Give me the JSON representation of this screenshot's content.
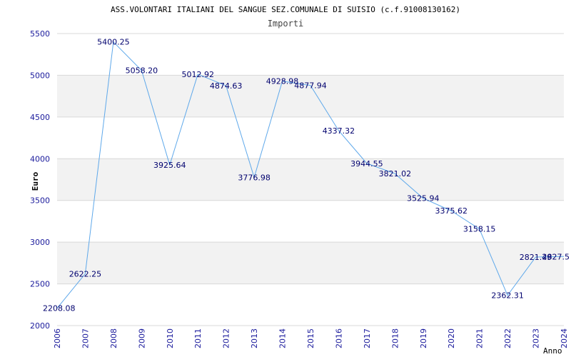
{
  "chart_data": {
    "type": "line",
    "title": "ASS.VOLONTARI ITALIANI DEL SANGUE SEZ.COMUNALE DI SUISIO (c.f.91008130162)",
    "subtitle": "Importi",
    "xlabel": "Anno",
    "ylabel": "Euro",
    "ylim": [
      2000,
      5500
    ],
    "yticks": [
      2000,
      2500,
      3000,
      3500,
      4000,
      4500,
      5000,
      5500
    ],
    "grid": true,
    "x": [
      2006,
      2007,
      2008,
      2009,
      2010,
      2011,
      2012,
      2013,
      2014,
      2015,
      2016,
      2017,
      2018,
      2019,
      2020,
      2021,
      2022,
      2023,
      2024
    ],
    "values": [
      2208.08,
      2622.25,
      5400.25,
      5058.2,
      3925.64,
      5012.92,
      4874.63,
      3776.98,
      4928.98,
      4877.94,
      4337.32,
      3944.55,
      3821.02,
      3525.94,
      3375.62,
      3158.15,
      2362.31,
      2821.49,
      2827.5
    ],
    "labels": [
      "2208.08",
      "2622.25",
      "5400.25",
      "5058.20",
      "3925.64",
      "5012.92",
      "4874.63",
      "3776.98",
      "4928.98",
      "4877.94",
      "4337.32",
      "3944.55",
      "3821.02",
      "3525.94",
      "3375.62",
      "3158.15",
      "2362.31",
      "2821.49",
      "2827.5"
    ],
    "colors": {
      "line": "#5ea8ea",
      "tick_text": "#1a1a9c",
      "label_text": "#00006e",
      "band": "#f2f2f2",
      "grid": "#d8d8d8"
    }
  }
}
